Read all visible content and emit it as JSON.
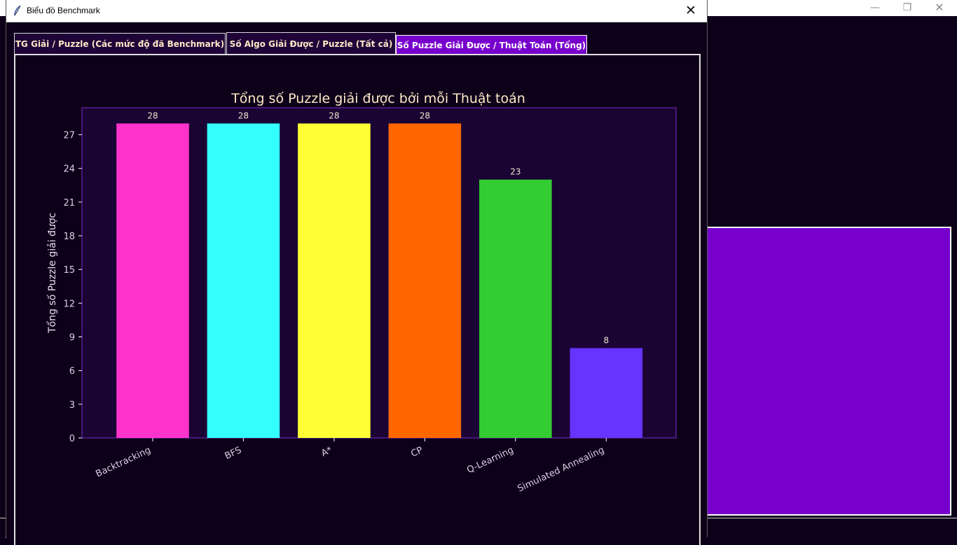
{
  "window": {
    "title": "Biểu đồ Benchmark",
    "close_glyph": "✕"
  },
  "background_window": {
    "minimize_glyph": "—",
    "maximize_glyph": "❐",
    "close_glyph": "✕"
  },
  "tabs": [
    {
      "label": "TG Giải / Puzzle (Các mức độ đã Benchmark)",
      "selected": false
    },
    {
      "label": "Số Algo Giải Được / Puzzle (Tất cả)",
      "selected": false
    },
    {
      "label": "Số Puzzle Giải Được / Thuật Toán (Tổng)",
      "selected": true
    }
  ],
  "colors": {
    "background": "#0d0019",
    "plot_area": "#1a0433",
    "accent": "#7700cc",
    "title_text": "#ffe8c8"
  },
  "chart_data": {
    "type": "bar",
    "title": "Tổng số Puzzle giải được bởi mỗi Thuật toán",
    "xlabel": "",
    "ylabel": "Tổng số Puzzle giải được",
    "categories": [
      "Backtracking",
      "BFS",
      "A*",
      "CP",
      "Q-Learning",
      "Simulated Annealing"
    ],
    "values": [
      28,
      28,
      28,
      28,
      23,
      8
    ],
    "bar_colors": [
      "#ff33cc",
      "#33ffff",
      "#ffff33",
      "#ff6600",
      "#33cc33",
      "#6633ff"
    ],
    "ylim": [
      0,
      29.4
    ],
    "yticks": [
      0,
      3,
      6,
      9,
      12,
      15,
      18,
      21,
      24,
      27
    ],
    "grid": false,
    "data_labels": true
  }
}
